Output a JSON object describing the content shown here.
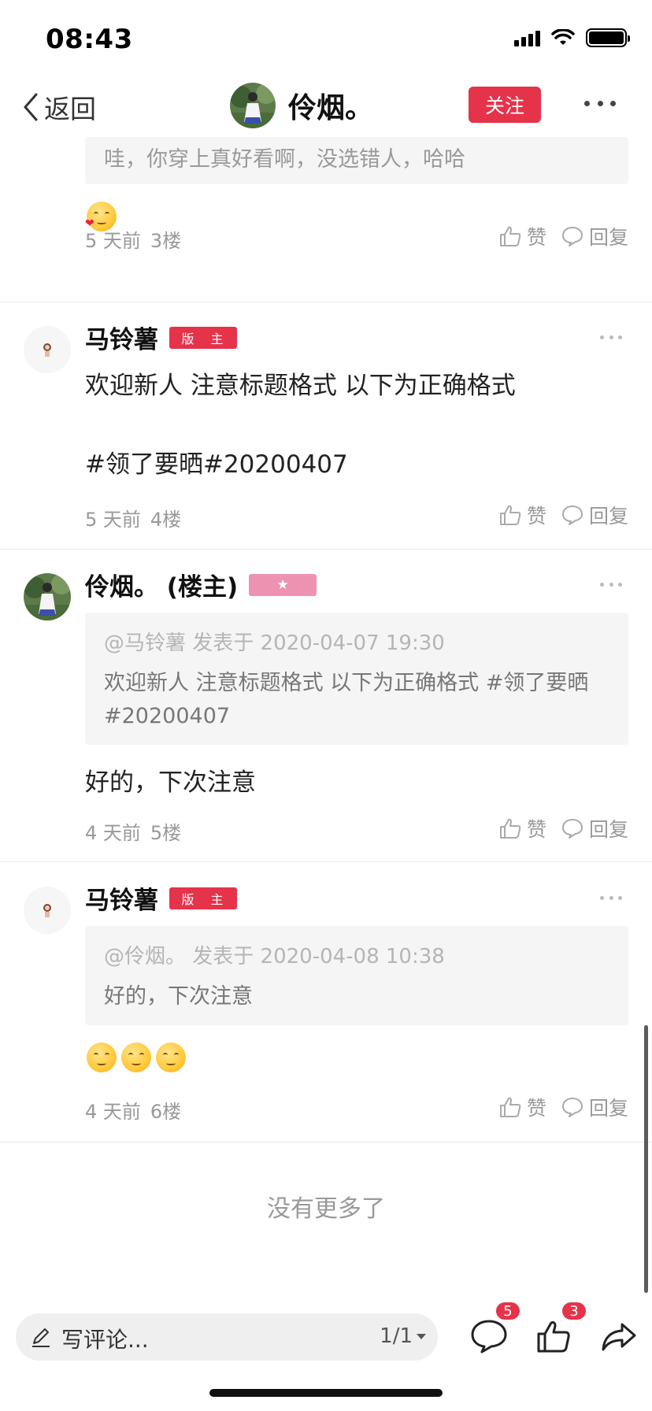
{
  "status_bar": {
    "time": "08:43"
  },
  "nav": {
    "back_label": "返回",
    "title": "伶烟。",
    "follow_label": "关注"
  },
  "posts": {
    "top_quote": "哇，你穿上真好看啊，没选错人，哈哈",
    "floor3": {
      "time": "5 天前",
      "floor": "3楼"
    },
    "floor4": {
      "author": "马铃薯",
      "badge": "版 主",
      "line1": "欢迎新人 注意标题格式 以下为正确格式",
      "line2": "#领了要晒#20200407",
      "time": "5 天前",
      "floor": "4楼"
    },
    "floor5": {
      "author": "伶烟。 (楼主)",
      "badge": "★",
      "quote_head": "@马铃薯 发表于 2020-04-07 19:30",
      "quote_line1": "欢迎新人 注意标题格式 以下为正确格式 #领了要晒",
      "quote_line2": "#20200407",
      "text": "好的，下次注意",
      "time": "4 天前",
      "floor": "5楼"
    },
    "floor6": {
      "author": "马铃薯",
      "badge": "版 主",
      "quote_head": "@伶烟。 发表于 2020-04-08 10:38",
      "quote_body": "好的，下次注意",
      "time": "4 天前",
      "floor": "6楼"
    },
    "like_label": "赞",
    "reply_label": "回复",
    "no_more": "没有更多了"
  },
  "bottom_bar": {
    "placeholder": "写评论...",
    "page_indicator": "1/1",
    "comment_count": "5",
    "like_count": "3"
  },
  "colors": {
    "accent": "#e5334a",
    "owner_badge": "#ee92b1"
  }
}
